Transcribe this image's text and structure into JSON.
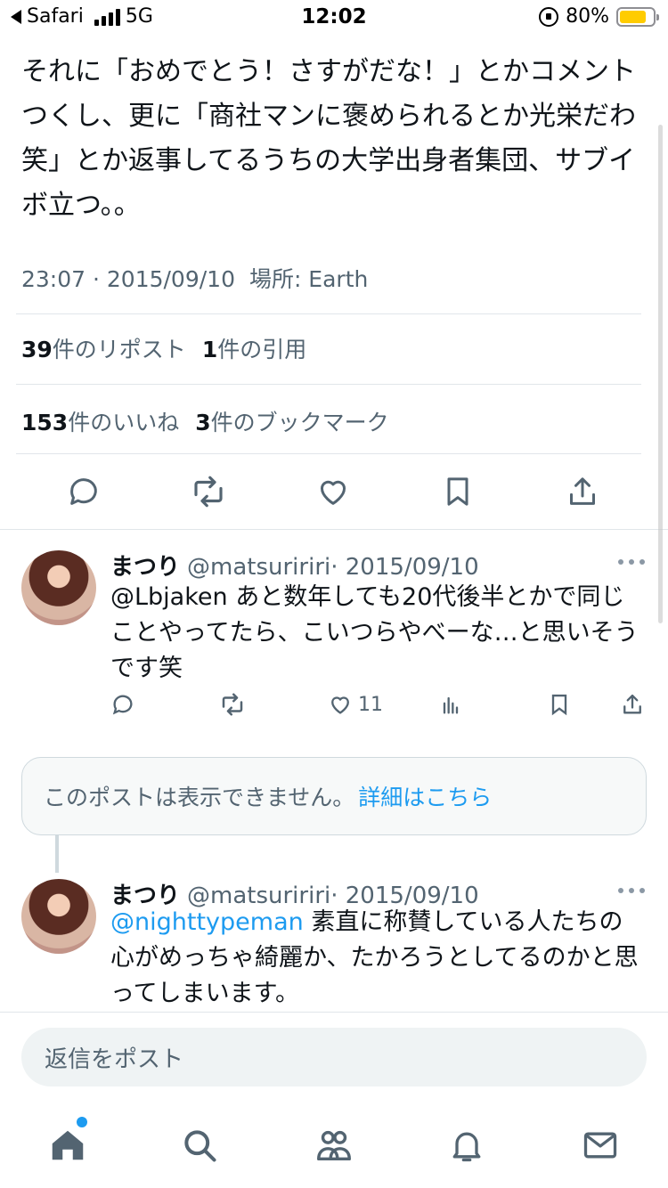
{
  "status_bar": {
    "back_app": "Safari",
    "network": "5G",
    "time": "12:02",
    "battery": "80%",
    "battery_level": 0.8
  },
  "tweet": {
    "text": "それに「おめでとう！さすがだな！」とかコメントつくし、更に「商社マンに褒められるとか光栄だわ笑」とか返事してるうちの大学出身者集団、サブイボ立つ。。",
    "timestamp": "23:07 · 2015/09/10",
    "location": "場所: Earth",
    "reposts_count": "39",
    "reposts_label": "件のリポスト",
    "quotes_count": "1",
    "quotes_label": "件の引用",
    "likes_count": "153",
    "likes_label": "件のいいね",
    "bookmarks_count": "3",
    "bookmarks_label": "件のブックマーク"
  },
  "replies": [
    {
      "name": "まつり",
      "handle": "@matsuririri",
      "date": "· 2015/09/10",
      "mention": "",
      "text": "@Lbjaken あと数年しても20代後半とかで同じことやってたら、こいつらやべーな…と思いそうです笑",
      "likes": "11"
    },
    {
      "name": "まつり",
      "handle": "@matsuririri",
      "date": "· 2015/09/10",
      "mention": "@nighttypeman",
      "text": " 素直に称賛している人たちの心がめっちゃ綺麗か、たかろうとしてるのかと思ってしまいます。"
    }
  ],
  "unavailable": {
    "text": "このポストは表示できません。",
    "link": "詳細はこちら"
  },
  "reply_box": {
    "placeholder": "返信をポスト"
  },
  "icons": {
    "colors": {
      "accent": "#1d9bf0",
      "text": "#0f1419",
      "muted": "#536471",
      "battery": "#ffcc00"
    }
  }
}
